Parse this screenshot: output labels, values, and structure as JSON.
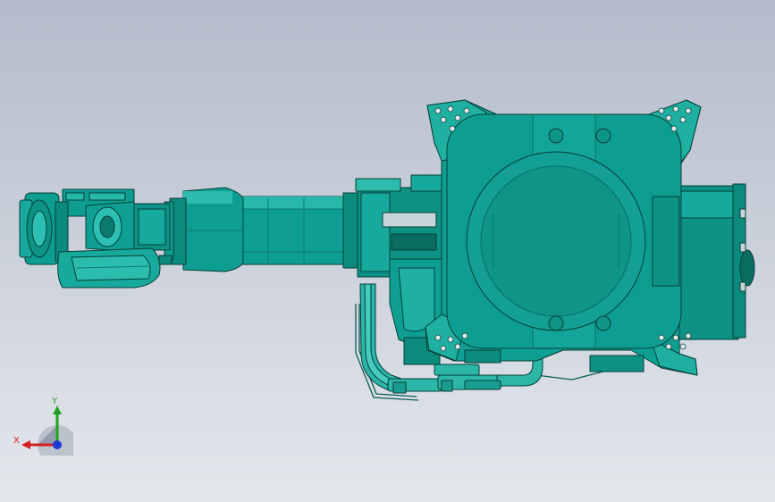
{
  "viewport": {
    "colors": {
      "model_fill": "#0e9e91",
      "model_fill_light": "#27b8aa",
      "model_fill_dark": "#077568",
      "edge": "#053f39",
      "pipe_fill": "#2bb6a8",
      "bg_top": "#b3bccb",
      "bg_bottom": "#e4e7ec"
    },
    "model": {
      "description_icon": "robot-arm-model"
    },
    "triad": {
      "x_label": "X",
      "y_label": "Y",
      "x_color": "#d32020",
      "y_color": "#1fa31f",
      "z_color": "#1e3ad6"
    }
  }
}
